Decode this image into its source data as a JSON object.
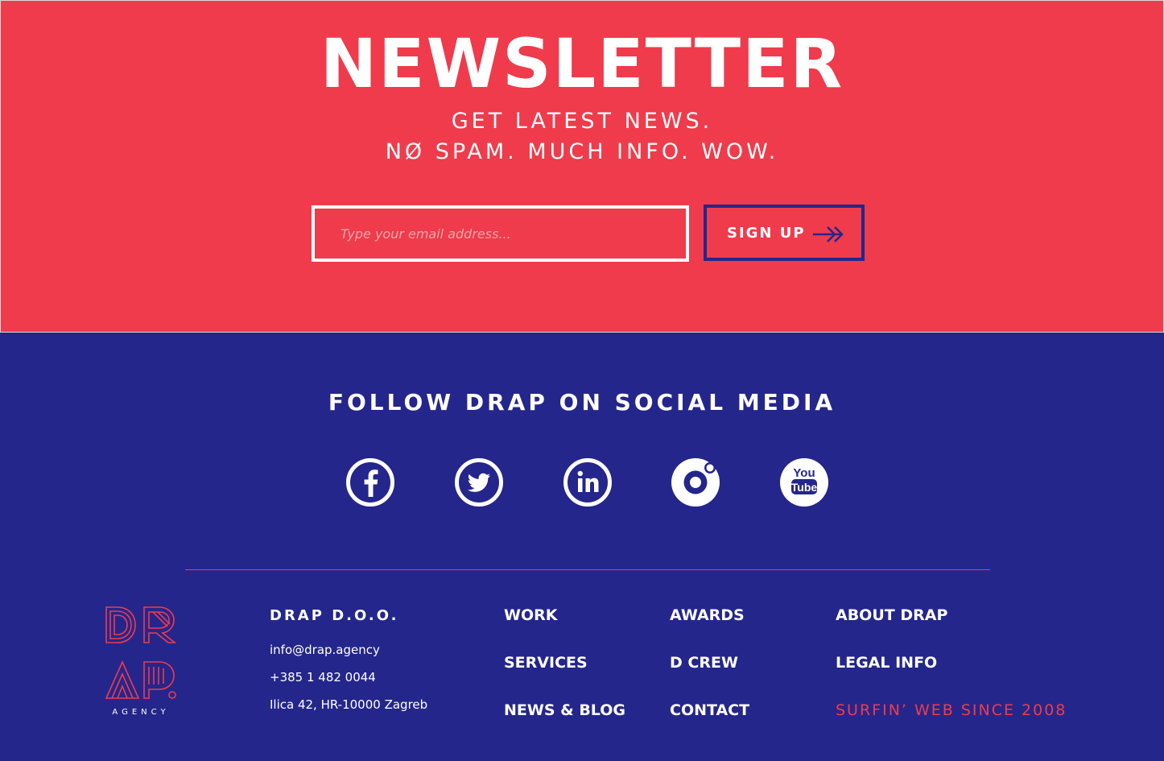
{
  "newsletter": {
    "title": "NEWSLETTER",
    "subtitle_line1": "GET LATEST NEWS.",
    "subtitle_line2": "NØ SPAM. MUCH INFO. WOW.",
    "email_placeholder": "Type your email address...",
    "signup_label": "SIGN UP"
  },
  "social": {
    "title": "FOLLOW DRAP ON SOCIAL MEDIA",
    "items": [
      {
        "icon": "facebook-icon"
      },
      {
        "icon": "twitter-icon"
      },
      {
        "icon": "linkedin-icon"
      },
      {
        "icon": "dribbble-icon"
      },
      {
        "icon": "youtube-icon",
        "text_top": "You",
        "text_bottom": "Tube"
      }
    ]
  },
  "footer": {
    "logo_letters": [
      "D",
      "R",
      "A",
      "P"
    ],
    "logo_sub": "AGENCY",
    "company": "DRAP D.O.O.",
    "email": "info@drap.agency",
    "phone": "+385 1 482 0044",
    "address": "Ilica 42, HR-10000 Zagreb",
    "nav_col1": [
      "WORK",
      "SERVICES",
      "NEWS & BLOG"
    ],
    "nav_col2": [
      "AWARDS",
      "D CREW",
      "CONTACT"
    ],
    "nav_col3": [
      "ABOUT DRAP",
      "LEGAL INFO"
    ],
    "tagline": "SURFIN’ WEB SINCE 2008"
  },
  "colors": {
    "red": "#ef3b4b",
    "blue": "#24268c",
    "white": "#ffffff"
  }
}
